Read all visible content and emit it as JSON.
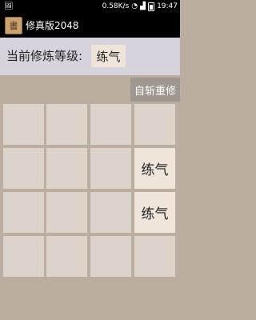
{
  "status_bar": {
    "network_speed": "0.58K/s",
    "time": "19:47",
    "icons": [
      "notification-icon",
      "wifi-icon",
      "signal-icon",
      "battery-icon"
    ]
  },
  "app": {
    "title": "修真版2048",
    "icon": "app-icon"
  },
  "header": {
    "level_label": "当前修炼等级:",
    "level_value": "练气"
  },
  "restart_label": "自斩重修",
  "board": {
    "rows": [
      [
        "",
        "",
        "",
        ""
      ],
      [
        "",
        "",
        "",
        "练气"
      ],
      [
        "",
        "",
        "",
        "练气"
      ],
      [
        "",
        "",
        "",
        ""
      ]
    ]
  },
  "colors": {
    "board_background": "#bbada0",
    "empty_cell": "#dcd3cb",
    "filled_cell": "#eee4da",
    "header_background": "#d6d3dc",
    "button_background": "#9e9891"
  }
}
